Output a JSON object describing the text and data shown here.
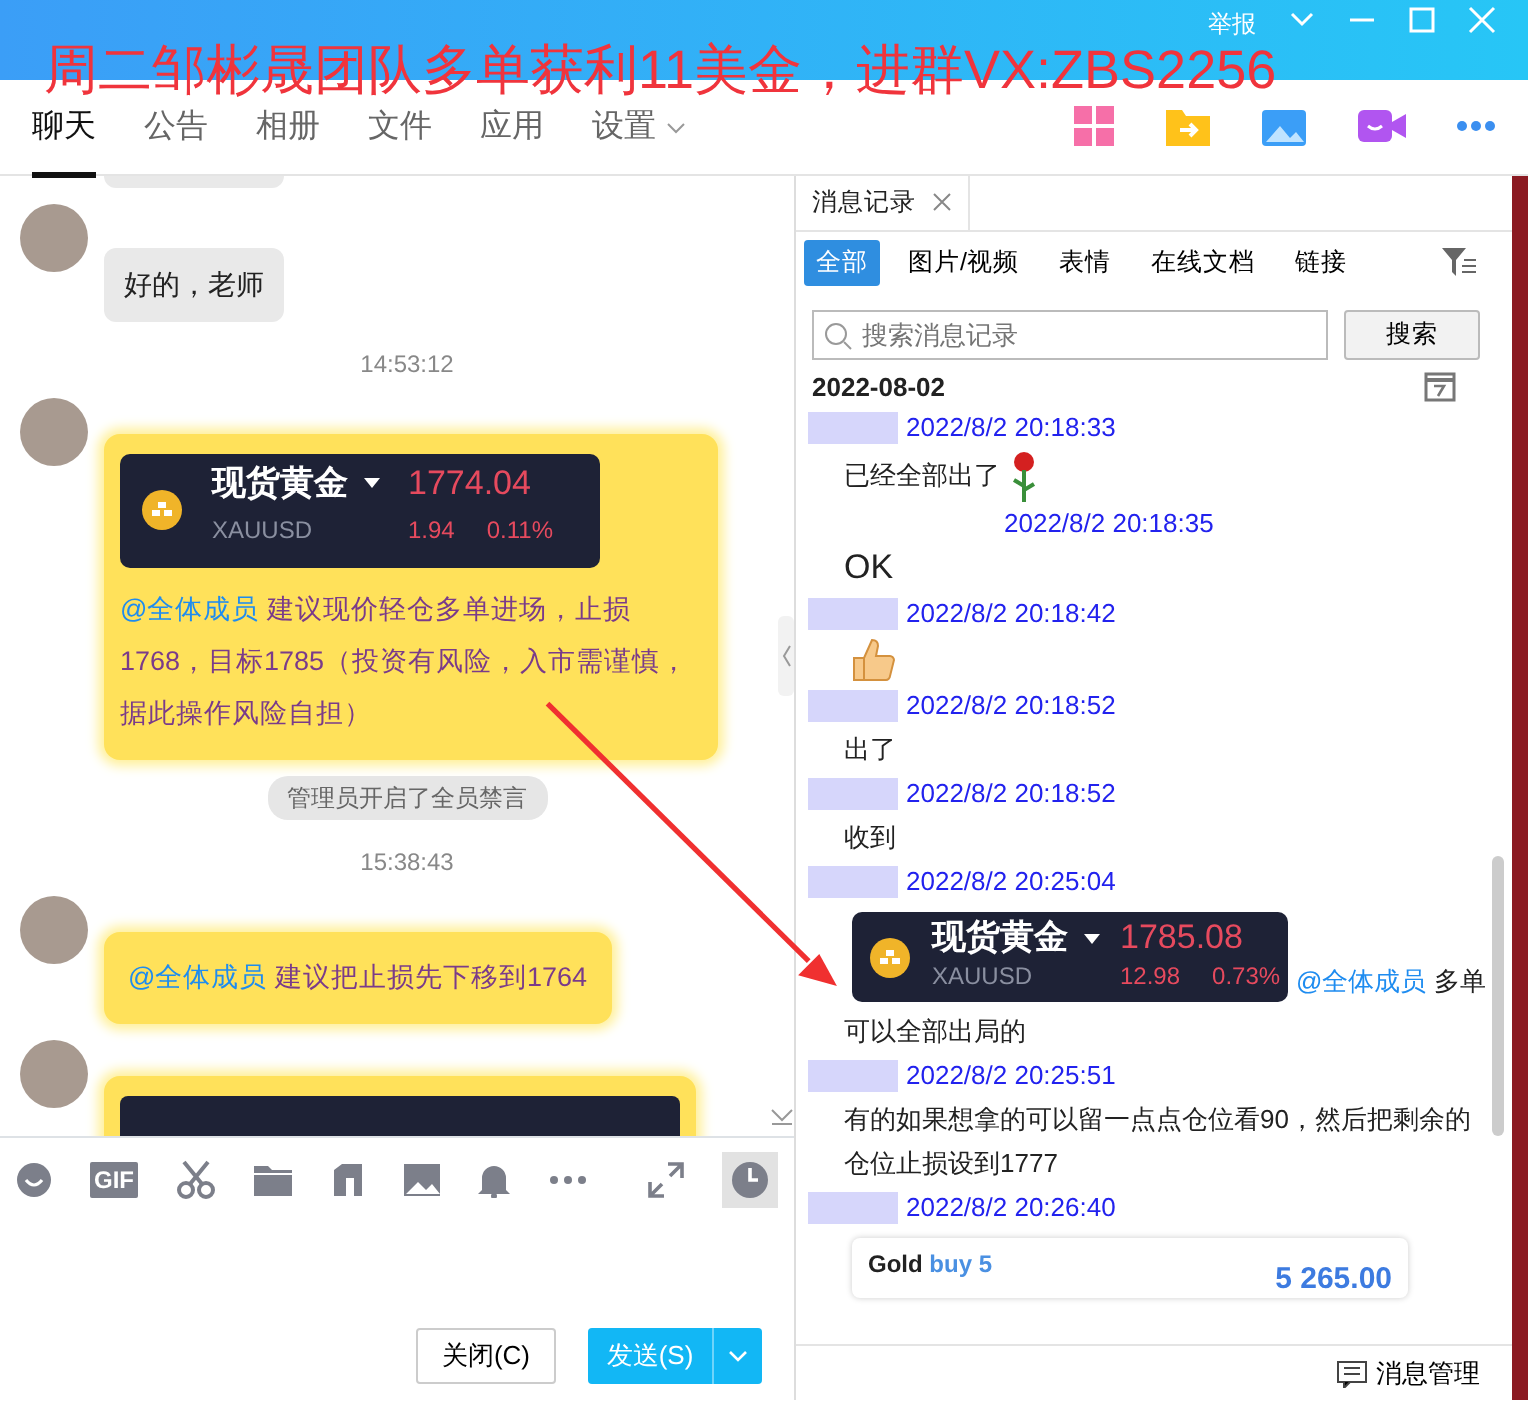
{
  "overlay_caption": "周二邹彬晟团队多单获利11美金，进群VX:ZBS2256",
  "title_bar": {
    "report": "举报"
  },
  "tabs": [
    {
      "label": "聊天",
      "selected": true,
      "dropdown": false
    },
    {
      "label": "公告",
      "selected": false,
      "dropdown": false
    },
    {
      "label": "相册",
      "selected": false,
      "dropdown": false
    },
    {
      "label": "文件",
      "selected": false,
      "dropdown": false
    },
    {
      "label": "应用",
      "selected": false,
      "dropdown": false
    },
    {
      "label": "设置",
      "selected": false,
      "dropdown": true
    }
  ],
  "chat": {
    "messages": [
      {
        "kind": "cut"
      },
      {
        "kind": "text",
        "text": "好的，老师"
      },
      {
        "kind": "time",
        "text": "14:53:12"
      },
      {
        "kind": "quote",
        "card": {
          "name": "现货黄金",
          "symbol": "XAUUSD",
          "price": "1774.04",
          "change": "1.94",
          "percent": "0.11%"
        },
        "mention": "@全体成员",
        "text": "建议现价轻仓多单进场，止损1768，目标1785（投资有风险，入市需谨慎，据此操作风险自担）"
      },
      {
        "kind": "system",
        "text": "管理员开启了全员禁言"
      },
      {
        "kind": "time",
        "text": "15:38:43"
      },
      {
        "kind": "mention",
        "mention": "@全体成员",
        "text": "建议把止损先下移到1764"
      },
      {
        "kind": "image"
      }
    ]
  },
  "toolbar": {
    "gif": "GIF"
  },
  "buttons": {
    "close": "关闭(C)",
    "send": "发送(S)"
  },
  "history": {
    "tab": "消息记录",
    "filters": [
      {
        "label": "全部",
        "selected": true
      },
      {
        "label": "图片/视频",
        "selected": false
      },
      {
        "label": "表情",
        "selected": false
      },
      {
        "label": "在线文档",
        "selected": false
      },
      {
        "label": "链接",
        "selected": false
      }
    ],
    "search": {
      "placeholder": "搜索消息记录",
      "button": "搜索"
    },
    "date": "2022-08-02",
    "entries": [
      {
        "kind": "time",
        "text": "2022/8/2 20:18:33"
      },
      {
        "kind": "rose_text",
        "text": "已经全部出了"
      },
      {
        "kind": "subtime",
        "text": "2022/8/2 20:18:35"
      },
      {
        "kind": "big",
        "text": "OK"
      },
      {
        "kind": "time",
        "text": "2022/8/2 20:18:42"
      },
      {
        "kind": "thumbs"
      },
      {
        "kind": "time",
        "text": "2022/8/2 20:18:52"
      },
      {
        "kind": "text",
        "text": "出了"
      },
      {
        "kind": "time",
        "text": "2022/8/2 20:18:52"
      },
      {
        "kind": "text",
        "text": "收到"
      },
      {
        "kind": "time",
        "text": "2022/8/2 20:25:04"
      },
      {
        "kind": "quote",
        "card": {
          "name": "现货黄金",
          "symbol": "XAUUSD",
          "price": "1785.08",
          "change": "12.98",
          "percent": "0.73%"
        },
        "mention": "@全体成员",
        "text": "多单"
      },
      {
        "kind": "text",
        "text": "可以全部出局的"
      },
      {
        "kind": "time",
        "text": "2022/8/2 20:25:51"
      },
      {
        "kind": "text",
        "text": "有的如果想拿的可以留一点点仓位看90，然后把剩余的仓位止损设到1777"
      },
      {
        "kind": "time",
        "text": "2022/8/2 20:26:40"
      },
      {
        "kind": "trade",
        "symbol": "Gold",
        "side": "buy 5",
        "amount": "5 265.00"
      }
    ],
    "footer": "消息管理"
  }
}
